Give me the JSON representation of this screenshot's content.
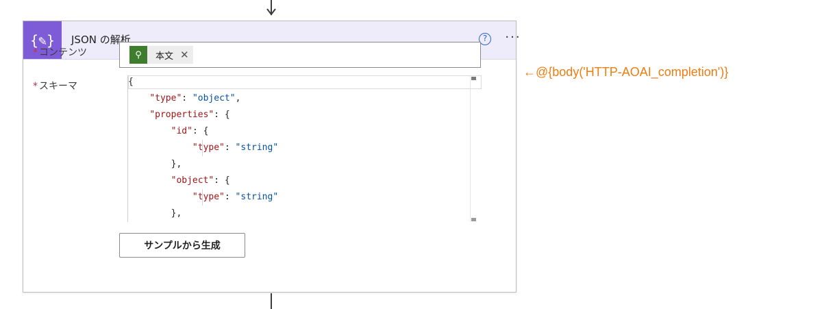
{
  "card": {
    "icon_glyph": "{✎}",
    "title": "JSON の解析",
    "help_glyph": "?",
    "more_glyph": "···"
  },
  "fields": {
    "content": {
      "required_mark": "*",
      "label": "コンテンツ",
      "token_icon_glyph": "⚲",
      "token_label": "本文",
      "token_close_glyph": "✕"
    },
    "schema": {
      "required_mark": "*",
      "label": "スキーマ",
      "lines": [
        {
          "indent": 0,
          "key": "",
          "value": "",
          "text": "{"
        },
        {
          "indent": 1,
          "key": "\"type\"",
          "value": "\"object\"",
          "suffix": ","
        },
        {
          "indent": 1,
          "key": "\"properties\"",
          "value": "",
          "suffix": ": {"
        },
        {
          "indent": 2,
          "key": "\"id\"",
          "value": "",
          "suffix": ": {"
        },
        {
          "indent": 3,
          "key": "\"type\"",
          "value": "\"string\"",
          "suffix": ""
        },
        {
          "indent": 2,
          "key": "",
          "value": "",
          "text": "},"
        },
        {
          "indent": 2,
          "key": "\"object\"",
          "value": "",
          "suffix": ": {"
        },
        {
          "indent": 3,
          "key": "\"type\"",
          "value": "\"string\"",
          "suffix": ""
        },
        {
          "indent": 2,
          "key": "",
          "value": "",
          "text": "},"
        }
      ]
    }
  },
  "generate_button_label": "サンプルから生成",
  "annotation": "←@{body('HTTP-AOAI_completion')}",
  "colors": {
    "header_bg": "#eeecfb",
    "action_icon_bg": "#7e5cd8",
    "token_icon_bg": "#3f7d2e",
    "json_key": "#a31515",
    "json_string": "#0451a5",
    "annotation": "#f07c10",
    "required": "#c4314b"
  }
}
